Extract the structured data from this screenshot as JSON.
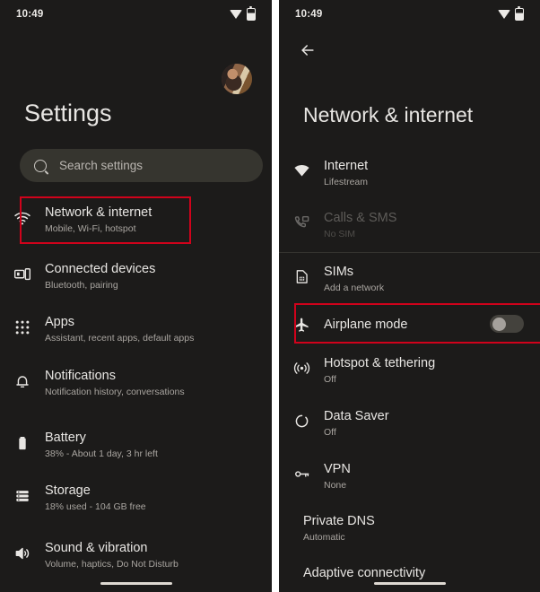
{
  "left_screen": {
    "status_bar": {
      "time": "10:49",
      "wifi_icon": "wifi-icon",
      "battery_icon": "battery-icon"
    },
    "avatar": "account-avatar",
    "title": "Settings",
    "search": {
      "placeholder": "Search settings",
      "icon": "search-icon"
    },
    "items": [
      {
        "icon": "wifi-icon",
        "title": "Network & internet",
        "subtitle": "Mobile, Wi-Fi, hotspot"
      },
      {
        "icon": "connected-devices-icon",
        "title": "Connected devices",
        "subtitle": "Bluetooth, pairing"
      },
      {
        "icon": "apps-grid-icon",
        "title": "Apps",
        "subtitle": "Assistant, recent apps, default apps"
      },
      {
        "icon": "bell-icon",
        "title": "Notifications",
        "subtitle": "Notification history, conversations"
      },
      {
        "icon": "battery-icon",
        "title": "Battery",
        "subtitle": "38% - About 1 day, 3 hr left"
      },
      {
        "icon": "storage-icon",
        "title": "Storage",
        "subtitle": "18% used - 104 GB free"
      },
      {
        "icon": "sound-icon",
        "title": "Sound & vibration",
        "subtitle": "Volume, haptics, Do Not Disturb"
      }
    ],
    "highlight_index": 0
  },
  "right_screen": {
    "status_bar": {
      "time": "10:49",
      "wifi_icon": "wifi-icon",
      "battery_icon": "battery-icon"
    },
    "back_button": "back-arrow-icon",
    "title": "Network & internet",
    "items": [
      {
        "icon": "wifi-icon",
        "title": "Internet",
        "subtitle": "Lifestream",
        "disabled": false,
        "toggle": null
      },
      {
        "icon": "calls-sms-icon",
        "title": "Calls & SMS",
        "subtitle": "No SIM",
        "disabled": true,
        "toggle": null
      },
      {
        "icon": "sim-card-icon",
        "title": "SIMs",
        "subtitle": "Add a network",
        "disabled": false,
        "toggle": null
      },
      {
        "icon": "airplane-icon",
        "title": "Airplane mode",
        "subtitle": "",
        "disabled": false,
        "toggle": "off"
      },
      {
        "icon": "hotspot-icon",
        "title": "Hotspot & tethering",
        "subtitle": "Off",
        "disabled": false,
        "toggle": null
      },
      {
        "icon": "data-saver-icon",
        "title": "Data Saver",
        "subtitle": "Off",
        "disabled": false,
        "toggle": null
      },
      {
        "icon": "vpn-key-icon",
        "title": "VPN",
        "subtitle": "None",
        "disabled": false,
        "toggle": null
      },
      {
        "icon": null,
        "title": "Private DNS",
        "subtitle": "Automatic",
        "disabled": false,
        "toggle": null
      },
      {
        "icon": null,
        "title": "Adaptive connectivity",
        "subtitle": "",
        "disabled": false,
        "toggle": null
      }
    ],
    "highlight_index": 3
  },
  "colors": {
    "background": "#1c1b1a",
    "highlight": "#d0021b",
    "primary_text": "#e8e6e3",
    "secondary_text": "#a9a5a0",
    "search_bg": "#36352f"
  }
}
